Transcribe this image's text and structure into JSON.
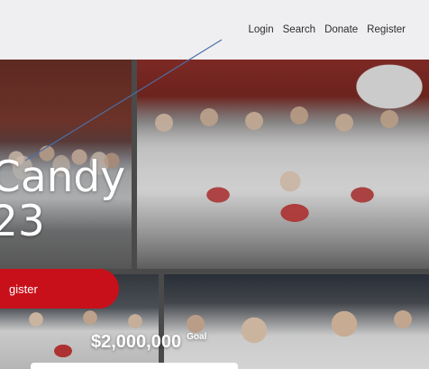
{
  "nav": {
    "items": [
      {
        "label": "Login"
      },
      {
        "label": "Search"
      },
      {
        "label": "Donate"
      },
      {
        "label": "Register"
      }
    ]
  },
  "hero": {
    "title_line1": "Candy",
    "title_line2": "23",
    "register_label": "gister",
    "goal_amount": "$2,000,000",
    "goal_label": "Goal"
  },
  "colors": {
    "topbar": "#efeff1",
    "accent": "#c8101a",
    "annotation_line": "#4a6fa5"
  }
}
